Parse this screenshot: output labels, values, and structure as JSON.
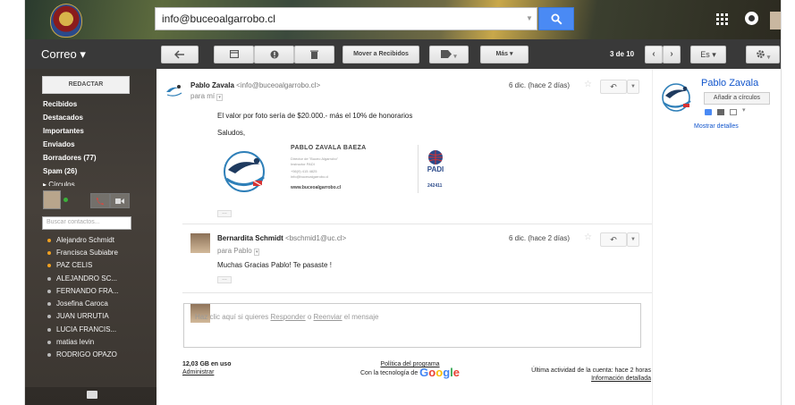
{
  "header": {
    "search_value": "info@buceoalgarrobo.cl",
    "apps_icon": "apps-grid-icon",
    "notifications_icon": "notifications-icon"
  },
  "toolbar": {
    "app_label": "Correo ▾",
    "back_icon": "back-arrow-icon",
    "archive_icon": "archive-icon",
    "spam_icon": "report-spam-icon",
    "delete_icon": "trash-icon",
    "move_label": "Mover a Recibidos",
    "labels_icon": "label-tag-icon",
    "more_label": "Más ▾",
    "pager_text": "3 de 10",
    "prev_icon": "chevron-left-icon",
    "next_icon": "chevron-right-icon",
    "lang_label": "Es ▾",
    "settings_icon": "gear-icon"
  },
  "sidebar": {
    "compose_label": "REDACTAR",
    "nav": [
      {
        "label": "Recibidos"
      },
      {
        "label": "Destacados"
      },
      {
        "label": "Importantes"
      },
      {
        "label": "Enviados"
      },
      {
        "label": "Borradores (77)"
      },
      {
        "label": "Spam (26)"
      },
      {
        "label": "▸ Círculos"
      }
    ],
    "contact_search_placeholder": "Buscar contactos...",
    "contacts": [
      {
        "name": "Alejandro Schmidt",
        "status_color": "#f0a020"
      },
      {
        "name": "Francisca Subiabre",
        "status_color": "#f0a020"
      },
      {
        "name": "PAZ CELIS",
        "status_color": "#f0a020"
      },
      {
        "name": "ALEJANDRO SC...",
        "status_color": "#bbbbbb"
      },
      {
        "name": "FERNANDO FRA...",
        "status_color": "#bbbbbb"
      },
      {
        "name": "Josefina Caroca",
        "status_color": "#bbbbbb"
      },
      {
        "name": "JUAN URRUTIA",
        "status_color": "#bbbbbb"
      },
      {
        "name": "LUCIA FRANCIS...",
        "status_color": "#bbbbbb"
      },
      {
        "name": "matias levin",
        "status_color": "#bbbbbb"
      },
      {
        "name": "RODRIGO OPAZO",
        "status_color": "#bbbbbb"
      }
    ]
  },
  "thread": {
    "messages": [
      {
        "sender_name": "Pablo Zavala",
        "sender_email": "<info@buceoalgarrobo.cl>",
        "to_line": "para mí",
        "date": "6 dic. (hace 2 días)",
        "body_line1": "El valor por foto sería de $20.000.- más el  10% de honorarios",
        "body_line2": "Saludos,"
      },
      {
        "sender_name": "Bernardita Schmidt",
        "sender_email": "<bschmid1@uc.cl>",
        "to_line": "para Pablo",
        "date": "6 dic. (hace 2 días)",
        "body_line1": "Muchas Gracias Pablo! Te pasaste !"
      }
    ],
    "signature": {
      "name": "PABLO ZAVALA BAEZA",
      "line1": "Director de \"Buceo Algarrobo\"",
      "line2": "Instructor PADI",
      "line3": "+56(9) 415 4825",
      "line4": "info@buceoalgarrobo.cl",
      "web": "www.buceoalgarrobo.cl",
      "padi_label": "PADI",
      "padi_number": "242411"
    },
    "reply_box": {
      "prefix": "Haz clic aquí si quieres ",
      "reply_link": "Responder",
      "middle": " o ",
      "forward_link": "Reenviar",
      "suffix": " el mensaje"
    },
    "ellipsis": "…",
    "reply_icon": "reply-arrow-icon",
    "more_icon": "chevron-down-icon",
    "star_icon": "star-outline-icon"
  },
  "footer": {
    "storage": "12,03 GB en uso",
    "manage": "Administrar",
    "policy": "Política del programa",
    "powered_prefix": "Con la tecnología de",
    "google": "Google",
    "activity": "Última actividad de la cuenta: hace 2 horas",
    "details": "Información detallada"
  },
  "contact_panel": {
    "name": "Pablo Zavala",
    "add_label": "Añadir a círculos",
    "show_details": "Mostrar detalles"
  },
  "colors": {
    "link_blue": "#1155cc",
    "search_blue": "#4a8af4",
    "online_green": "#3bb13b"
  }
}
